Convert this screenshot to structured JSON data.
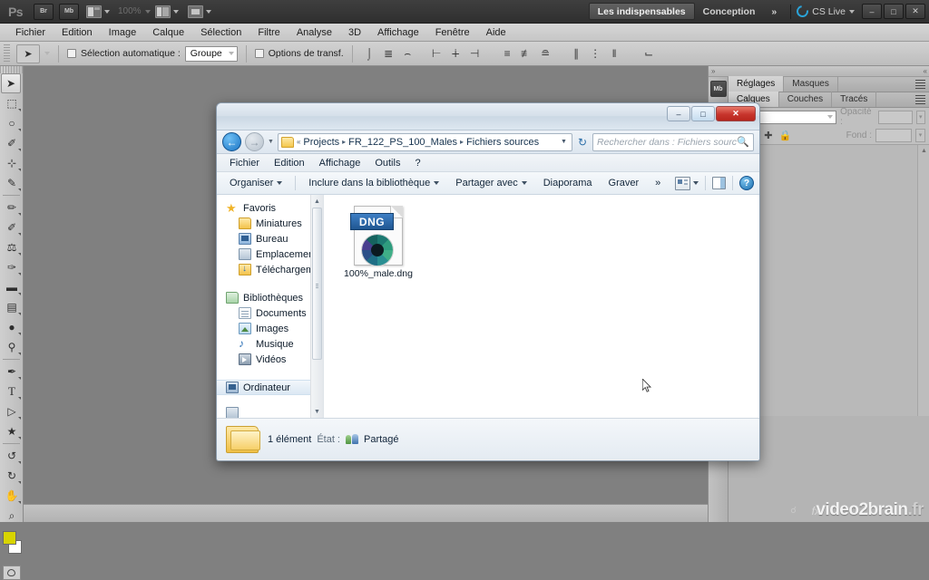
{
  "photoshop": {
    "titlebar": {
      "logo": "Ps",
      "buttons": [
        {
          "name": "bridge",
          "label": "Br"
        },
        {
          "name": "mini-bridge",
          "label": "Mb"
        }
      ],
      "zoom_level": "100%",
      "workspaces": [
        {
          "label": "Les indispensables",
          "active": true
        },
        {
          "label": "Conception",
          "active": false
        }
      ],
      "more_workspaces": "»",
      "cs_live": "CS Live",
      "window_controls": [
        "–",
        "□",
        "✕"
      ]
    },
    "menubar": [
      "Fichier",
      "Edition",
      "Image",
      "Calque",
      "Sélection",
      "Filtre",
      "Analyse",
      "3D",
      "Affichage",
      "Fenêtre",
      "Aide"
    ],
    "optionsbar": {
      "tool_icon": "move-tool",
      "auto_select_label": "Sélection automatique :",
      "auto_select_value": "Groupe",
      "transform_label": "Options de transf.",
      "align_group_1": [
        "align-top-edges",
        "align-vertical-centers",
        "align-bottom-edges"
      ],
      "align_group_2": [
        "align-left-edges",
        "align-horizontal-centers",
        "align-right-edges"
      ],
      "align_group_3": [
        "distribute-top",
        "distribute-vertical-center",
        "distribute-bottom"
      ],
      "align_group_4": [
        "distribute-left",
        "distribute-horizontal-center",
        "distribute-right"
      ],
      "align_group_5": [
        "auto-align-layers"
      ]
    },
    "toolbox": [
      {
        "name": "move-tool",
        "glyph": "➤",
        "selected": true
      },
      {
        "name": "marquee-tool",
        "glyph": "⬚",
        "selected": false
      },
      {
        "name": "lasso-tool",
        "glyph": "○",
        "selected": false
      },
      {
        "name": "quick-selection-tool",
        "glyph": "✎",
        "selected": false
      },
      {
        "name": "crop-tool",
        "glyph": "⊡",
        "selected": false
      },
      {
        "name": "eyedropper-tool",
        "glyph": "✒",
        "selected": false
      },
      {
        "name": "healing-brush-tool",
        "glyph": "✇",
        "selected": false
      },
      {
        "name": "brush-tool",
        "glyph": "✐",
        "selected": false
      },
      {
        "name": "clone-stamp-tool",
        "glyph": "⚑",
        "selected": false
      },
      {
        "name": "history-brush-tool",
        "glyph": "✒",
        "selected": false
      },
      {
        "name": "eraser-tool",
        "glyph": "▰",
        "selected": false
      },
      {
        "name": "gradient-tool",
        "glyph": "▤",
        "selected": false
      },
      {
        "name": "blur-tool",
        "glyph": "●",
        "selected": false
      },
      {
        "name": "dodge-tool",
        "glyph": "⚲",
        "selected": false
      },
      {
        "name": "pen-tool",
        "glyph": "✒",
        "selected": false
      },
      {
        "name": "type-tool",
        "glyph": "T",
        "selected": false
      },
      {
        "name": "path-selection-tool",
        "glyph": "➤",
        "selected": false
      },
      {
        "name": "shape-tool",
        "glyph": "⬟",
        "selected": false
      },
      {
        "name": "3d-object-rotate-tool",
        "glyph": "↺",
        "selected": false
      },
      {
        "name": "3d-camera-rotate-tool",
        "glyph": "↻",
        "selected": false
      },
      {
        "name": "hand-tool",
        "glyph": "✋",
        "selected": false
      },
      {
        "name": "zoom-tool",
        "glyph": "⌕",
        "selected": false
      }
    ],
    "colors": {
      "foreground": "#d8d400",
      "background": "#ffffff"
    },
    "dock": {
      "rail_buttons": [
        {
          "name": "mini-bridge-rail",
          "label": "Mb"
        }
      ],
      "panel_group_1": {
        "tabs": [
          {
            "label": "Réglages",
            "active": true
          },
          {
            "label": "Masques",
            "active": false
          }
        ]
      },
      "panel_group_2": {
        "tabs": [
          {
            "label": "Calques",
            "active": true
          },
          {
            "label": "Couches",
            "active": false
          },
          {
            "label": "Tracés",
            "active": false
          }
        ],
        "opacity_label": "Opacité :",
        "fill_label": "Fond :"
      }
    }
  },
  "explorer": {
    "window_controls": {
      "minimize": "–",
      "maximize": "□",
      "close": "✕"
    },
    "address": {
      "back": "←",
      "forward": "→",
      "breadcrumb_prefix": "«",
      "breadcrumb": [
        "Projects",
        "FR_122_PS_100_Males",
        "Fichiers sources"
      ],
      "separator": "▸",
      "refresh": "↻"
    },
    "search": {
      "placeholder": "Rechercher dans : Fichiers sources",
      "icon": "search-icon"
    },
    "menubar": [
      "Fichier",
      "Edition",
      "Affichage",
      "Outils",
      "?"
    ],
    "toolbar": {
      "items": [
        {
          "label": "Organiser",
          "has_caret": true
        },
        {
          "label": "Inclure dans la bibliothèque",
          "has_caret": true
        },
        {
          "label": "Partager avec",
          "has_caret": true
        },
        {
          "label": "Diaporama",
          "has_caret": false
        },
        {
          "label": "Graver",
          "has_caret": false
        }
      ],
      "overflow": "»",
      "help": "?"
    },
    "navigation": {
      "groups": [
        {
          "root": {
            "label": "Favoris",
            "icon": "star-icon"
          },
          "children": [
            {
              "label": "Miniatures",
              "icon": "folder-icon"
            },
            {
              "label": "Bureau",
              "icon": "desktop-icon"
            },
            {
              "label": "Emplacements ré",
              "icon": "network-places-icon"
            },
            {
              "label": "Téléchargements",
              "icon": "downloads-icon"
            }
          ]
        },
        {
          "root": {
            "label": "Bibliothèques",
            "icon": "library-icon"
          },
          "children": [
            {
              "label": "Documents",
              "icon": "document-icon"
            },
            {
              "label": "Images",
              "icon": "pictures-icon"
            },
            {
              "label": "Musique",
              "icon": "music-icon"
            },
            {
              "label": "Vidéos",
              "icon": "video-icon"
            }
          ]
        },
        {
          "root": {
            "label": "Ordinateur",
            "icon": "computer-icon",
            "selected": true
          },
          "children": []
        }
      ]
    },
    "files": [
      {
        "name": "100%_male.dng",
        "type": "DNG",
        "badge": "DNG"
      }
    ],
    "details": {
      "item_count": "1 élément",
      "state_label": "État :",
      "share_status": "Partagé"
    }
  },
  "watermark": {
    "brand": "video2brain",
    "tld": ".fr"
  }
}
